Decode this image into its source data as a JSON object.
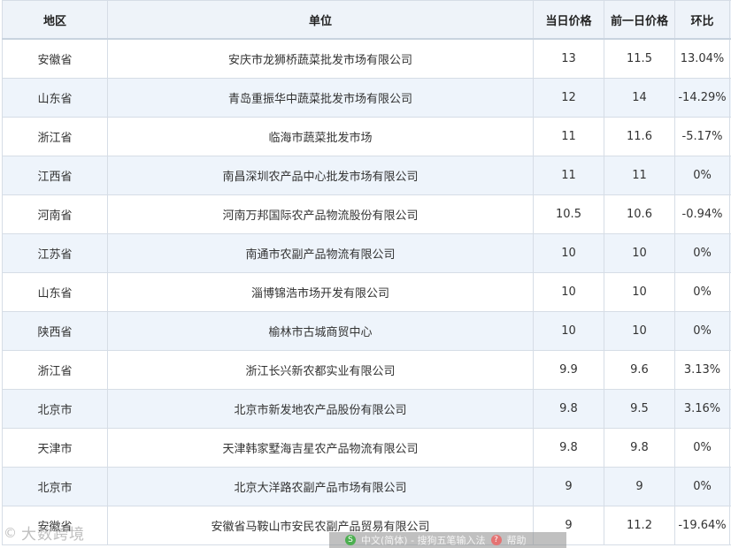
{
  "table": {
    "headers": {
      "region": "地区",
      "unit": "单位",
      "today_price": "当日价格",
      "prev_price": "前一日价格",
      "change": "环比"
    },
    "rows": [
      {
        "region": "安徽省",
        "unit": "安庆市龙狮桥蔬菜批发市场有限公司",
        "today": "13",
        "prev": "11.5",
        "change": "13.04%"
      },
      {
        "region": "山东省",
        "unit": "青岛重振华中蔬菜批发市场有限公司",
        "today": "12",
        "prev": "14",
        "change": "-14.29%"
      },
      {
        "region": "浙江省",
        "unit": "临海市蔬菜批发市场",
        "today": "11",
        "prev": "11.6",
        "change": "-5.17%"
      },
      {
        "region": "江西省",
        "unit": "南昌深圳农产品中心批发市场有限公司",
        "today": "11",
        "prev": "11",
        "change": "0%"
      },
      {
        "region": "河南省",
        "unit": "河南万邦国际农产品物流股份有限公司",
        "today": "10.5",
        "prev": "10.6",
        "change": "-0.94%"
      },
      {
        "region": "江苏省",
        "unit": "南通市农副产品物流有限公司",
        "today": "10",
        "prev": "10",
        "change": "0%"
      },
      {
        "region": "山东省",
        "unit": "淄博锦浩市场开发有限公司",
        "today": "10",
        "prev": "10",
        "change": "0%"
      },
      {
        "region": "陕西省",
        "unit": "榆林市古城商贸中心",
        "today": "10",
        "prev": "10",
        "change": "0%"
      },
      {
        "region": "浙江省",
        "unit": "浙江长兴新农都实业有限公司",
        "today": "9.9",
        "prev": "9.6",
        "change": "3.13%"
      },
      {
        "region": "北京市",
        "unit": "北京市新发地农产品股份有限公司",
        "today": "9.8",
        "prev": "9.5",
        "change": "3.16%"
      },
      {
        "region": "天津市",
        "unit": "天津韩家墅海吉星农产品物流有限公司",
        "today": "9.8",
        "prev": "9.8",
        "change": "0%"
      },
      {
        "region": "北京市",
        "unit": "北京大洋路农副产品市场有限公司",
        "today": "9",
        "prev": "9",
        "change": "0%"
      },
      {
        "region": "安徽省",
        "unit": "安徽省马鞍山市安民农副产品贸易有限公司",
        "today": "9",
        "prev": "11.2",
        "change": "-19.64%"
      }
    ]
  },
  "watermark": {
    "text": "大数跨境",
    "icon": "camera-watermark-icon"
  },
  "ime": {
    "status": "中文(简体) - 搜狗五笔输入法",
    "help": "帮助",
    "logo_icon": "sogou-logo-icon",
    "help_icon": "help-icon"
  },
  "colors": {
    "header_bg": "#eef3f9",
    "alt_row_bg": "#eef4fb",
    "border": "#d6dde6"
  }
}
